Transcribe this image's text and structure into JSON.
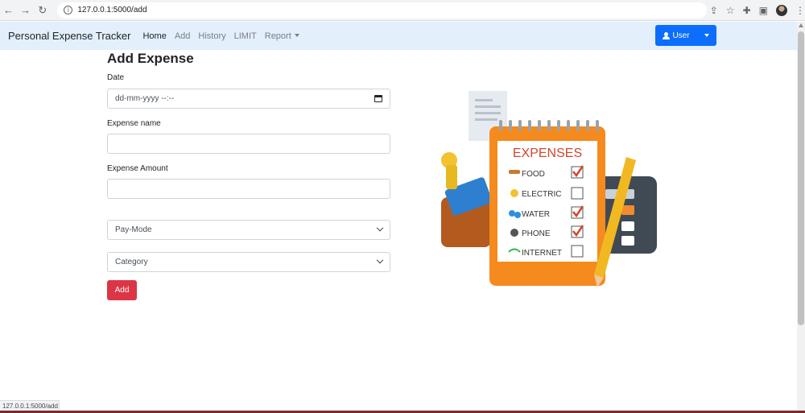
{
  "browser": {
    "url": "127.0.0.1:5000/add",
    "status_url": "127.0.0.1:5000/add"
  },
  "navbar": {
    "brand": "Personal Expense Tracker",
    "links": [
      {
        "label": "Home"
      },
      {
        "label": "Add"
      },
      {
        "label": "History"
      },
      {
        "label": "LIMIT"
      },
      {
        "label": "Report"
      }
    ],
    "user_label": "User",
    "accent": "#0d6efd",
    "background": "#e3effb"
  },
  "form": {
    "title": "Add Expense",
    "date_label": "Date",
    "date_placeholder": "dd-mm-yyyy --:--",
    "name_label": "Expense name",
    "name_value": "",
    "amount_label": "Expense Amount",
    "amount_value": "",
    "paymode_selected": "Pay-Mode",
    "category_selected": "Category",
    "submit_label": "Add",
    "submit_color": "#dc3545"
  },
  "illustration": {
    "title": "EXPENSES",
    "items": [
      {
        "label": "FOOD",
        "checked": true
      },
      {
        "label": "ELECTRIC",
        "checked": false
      },
      {
        "label": "WATER",
        "checked": true
      },
      {
        "label": "PHONE",
        "checked": true
      },
      {
        "label": "INTERNET",
        "checked": false
      }
    ]
  }
}
